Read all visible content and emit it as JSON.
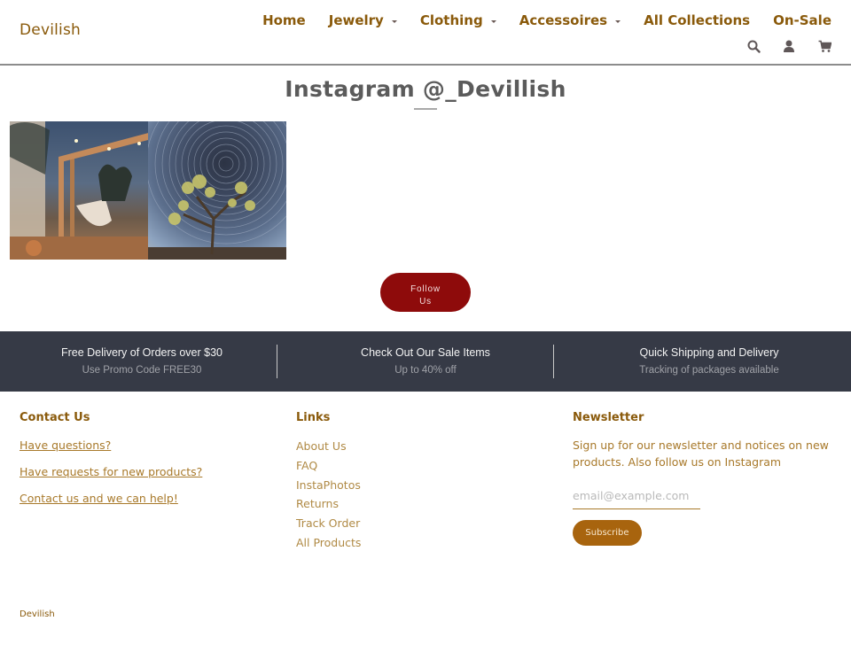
{
  "header": {
    "logo": "Devilish",
    "nav": [
      {
        "label": "Home",
        "dropdown": false
      },
      {
        "label": "Jewelry",
        "dropdown": true
      },
      {
        "label": "Clothing",
        "dropdown": true
      },
      {
        "label": "Accessoires",
        "dropdown": true
      },
      {
        "label": "All Collections",
        "dropdown": false
      },
      {
        "label": "On-Sale",
        "dropdown": false
      }
    ],
    "icons": [
      "search-icon",
      "account-icon",
      "cart-icon"
    ]
  },
  "instagram": {
    "title": "Instagram @_Devillish",
    "photos": [
      {
        "alt": "Woman in hammock under string lights at desert campsite"
      },
      {
        "alt": "Joshua tree under circular star trails"
      }
    ],
    "follow_label_line1": "Follow",
    "follow_label_line2": "Us"
  },
  "promo": [
    {
      "title": "Free Delivery of Orders over $30",
      "subtitle": "Use Promo Code FREE30"
    },
    {
      "title": "Check Out Our Sale Items",
      "subtitle": "Up to 40% off"
    },
    {
      "title": "Quick Shipping and Delivery",
      "subtitle": "Tracking of packages available"
    }
  ],
  "footer": {
    "contact": {
      "heading": "Contact Us",
      "links": [
        "Have questions?",
        "Have requests for new products?",
        "Contact us and we can help!"
      ]
    },
    "links": {
      "heading": "Links",
      "items": [
        "About Us",
        "FAQ",
        "InstaPhotos",
        "Returns",
        "Track Order",
        "All Products"
      ]
    },
    "newsletter": {
      "heading": "Newsletter",
      "text": "Sign up for our newsletter and notices on new products. Also follow us on Instagram",
      "email_placeholder": "email@example.com",
      "email_value": "",
      "subscribe_label": "Subscribe"
    },
    "copyright": "Devilish"
  },
  "colors": {
    "brand": "#8a5a0b",
    "follow_button": "#8e0b0b",
    "promo_bar": "#363a46",
    "subscribe_button": "#a8640e"
  }
}
